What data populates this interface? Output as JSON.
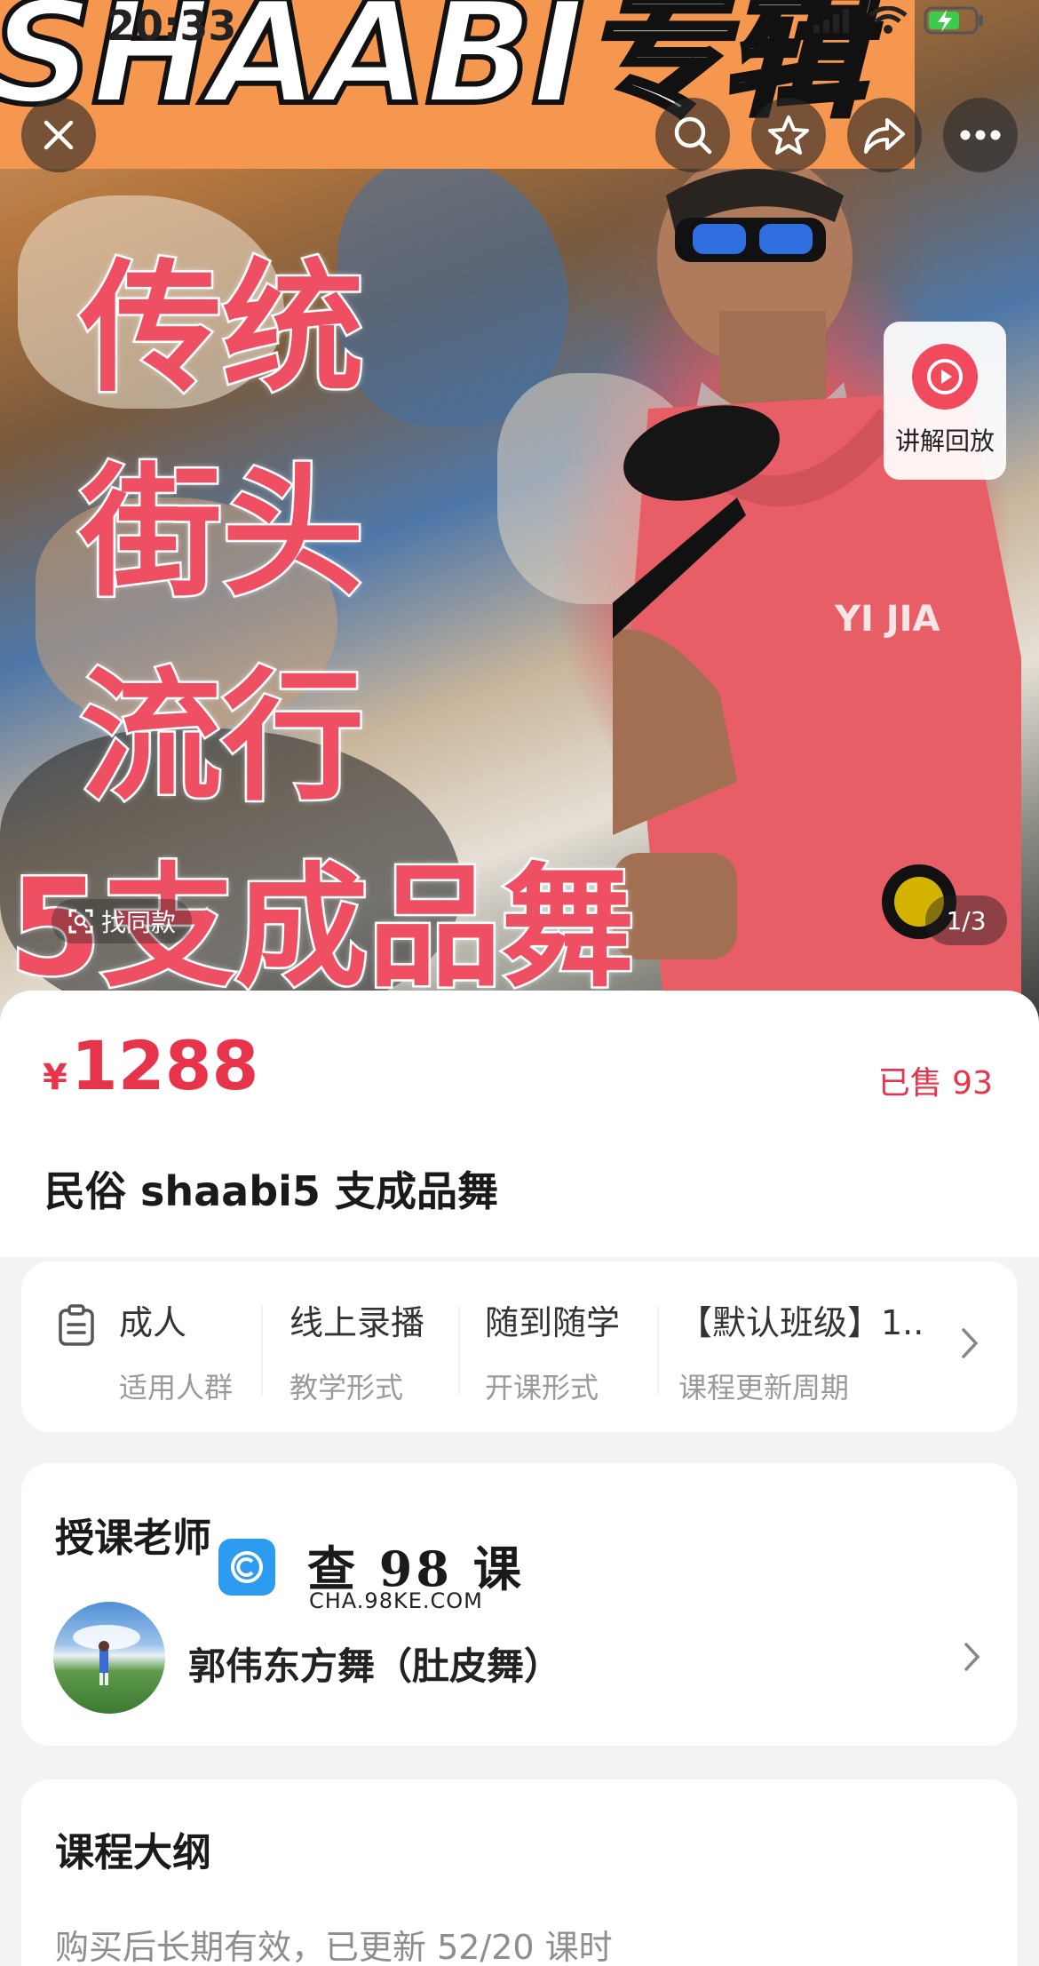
{
  "status_bar": {
    "time": "20:33"
  },
  "hero": {
    "banner_text": "SHAABI专辑",
    "title_lines": [
      "传统",
      "街头",
      "流行",
      "5支成品舞"
    ],
    "shirt_text": "YI JIA",
    "replay_label": "讲解回放",
    "find_same_label": "找同款",
    "page_indicator": "1/3"
  },
  "toolbar": {
    "close_icon": "close-icon",
    "search_icon": "search-icon",
    "favorite_icon": "star-icon",
    "share_icon": "share-icon",
    "more_icon": "more-icon"
  },
  "product": {
    "currency": "¥",
    "price": "1288",
    "sold": "已售 93",
    "title": "民俗 shaabi5 支成品舞",
    "accent_color": "#e8344a"
  },
  "attributes": [
    {
      "value": "成人",
      "label": "适用人群"
    },
    {
      "value": "线上录播",
      "label": "教学形式"
    },
    {
      "value": "随到随学",
      "label": "开课形式"
    },
    {
      "value": "【默认班级】1..",
      "label": "课程更新周期"
    }
  ],
  "teacher": {
    "section_title": "授课老师",
    "name": "郭伟东方舞（肚皮舞）"
  },
  "watermark": {
    "title": "查 98 课",
    "subtitle": "CHA.98KE.COM"
  },
  "outline": {
    "section_title": "课程大纲",
    "description": "购买后长期有效，已更新 52/20 课时"
  }
}
